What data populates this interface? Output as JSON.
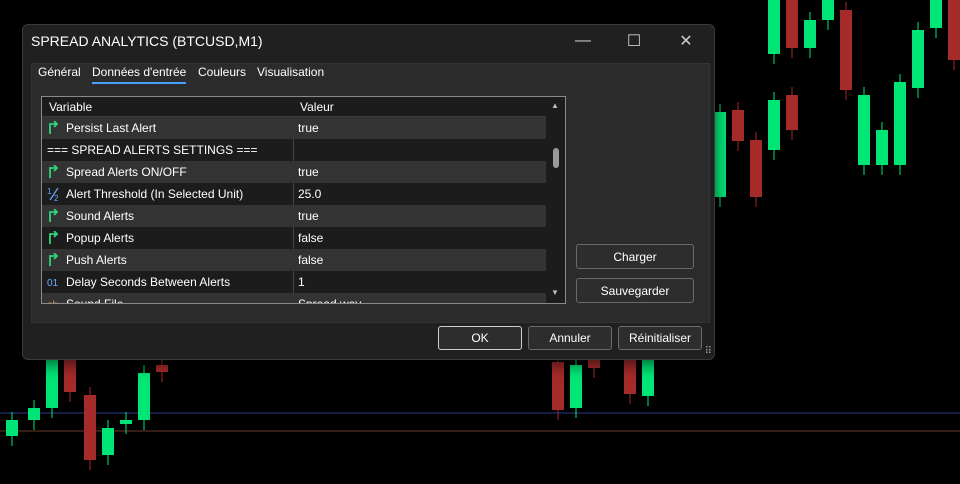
{
  "window": {
    "title": "SPREAD ANALYTICS (BTCUSD,M1)",
    "controls": {
      "minimize": "—",
      "maximize": "☐",
      "close": "✕"
    }
  },
  "tabs": [
    "Général",
    "Données d'entrée",
    "Couleurs",
    "Visualisation"
  ],
  "active_tab": 1,
  "grid": {
    "headers": {
      "variable": "Variable",
      "value": "Valeur"
    },
    "rows": [
      {
        "icon": "bool-icon",
        "name": "Persist Last Alert",
        "value": "true"
      },
      {
        "icon": "none",
        "name": "=== SPREAD ALERTS SETTINGS ===",
        "value": ""
      },
      {
        "icon": "bool-icon",
        "name": "Spread Alerts ON/OFF",
        "value": "true"
      },
      {
        "icon": "fraction-icon",
        "name": "Alert Threshold (In Selected Unit)",
        "value": "25.0"
      },
      {
        "icon": "bool-icon",
        "name": "Sound Alerts",
        "value": "true"
      },
      {
        "icon": "bool-icon",
        "name": "Popup Alerts",
        "value": "false"
      },
      {
        "icon": "bool-icon",
        "name": "Push Alerts",
        "value": "false"
      },
      {
        "icon": "integer-icon",
        "name": "Delay Seconds Between Alerts",
        "value": "1"
      },
      {
        "icon": "string-icon",
        "name": "Sound File",
        "value": "Spread.wav"
      }
    ]
  },
  "side_buttons": {
    "load": "Charger",
    "save": "Sauvegarder"
  },
  "footer_buttons": {
    "ok": "OK",
    "cancel": "Annuler",
    "reset": "Réinitialiser"
  },
  "colors": {
    "bull": "#00e676",
    "bear": "#a52a2a",
    "accent": "#4aa0ff"
  }
}
